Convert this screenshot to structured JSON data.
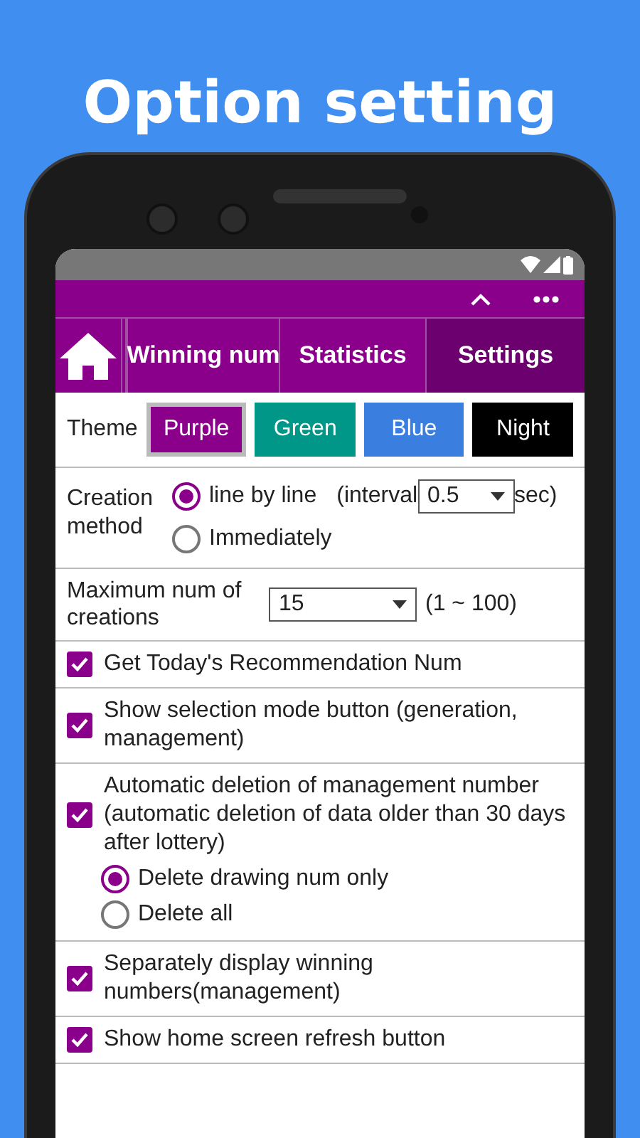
{
  "headline": "Option setting",
  "tabs": [
    {
      "kind": "home",
      "selected": false
    },
    {
      "kind": "text",
      "label": "Winning num",
      "selected": false
    },
    {
      "kind": "text",
      "label": "Statistics",
      "selected": false
    },
    {
      "kind": "text",
      "label": "Settings",
      "selected": true
    }
  ],
  "theme": {
    "label": "Theme",
    "options": [
      {
        "label": "Purple",
        "color": "#8b008b",
        "selected": true
      },
      {
        "label": "Green",
        "color": "#009688",
        "selected": false
      },
      {
        "label": "Blue",
        "color": "#3a7fe0",
        "selected": false
      },
      {
        "label": "Night",
        "color": "#000000",
        "selected": false
      }
    ]
  },
  "creation_method": {
    "label": "Creation method",
    "options": [
      {
        "label": "line by line",
        "selected": true
      },
      {
        "label": "Immediately",
        "selected": false
      }
    ],
    "interval_label": "(interval",
    "interval_value": "0.5",
    "interval_unit": "sec)"
  },
  "max_creations": {
    "label": "Maximum num of creations",
    "value": "15",
    "range": "(1 ~ 100)"
  },
  "options": [
    {
      "label": "Get Today's Recommendation Num",
      "checked": true
    },
    {
      "label": "Show selection mode button (generation, management)",
      "checked": true
    },
    {
      "label": "Automatic deletion of management number (automatic deletion of data older than 30 days after lottery)",
      "checked": true,
      "choices": [
        {
          "label": "Delete drawing num only",
          "selected": true
        },
        {
          "label": "Delete all",
          "selected": false
        }
      ]
    },
    {
      "label": "Separately display winning numbers(management)",
      "checked": true
    },
    {
      "label": "Show home screen refresh button",
      "checked": true
    }
  ]
}
